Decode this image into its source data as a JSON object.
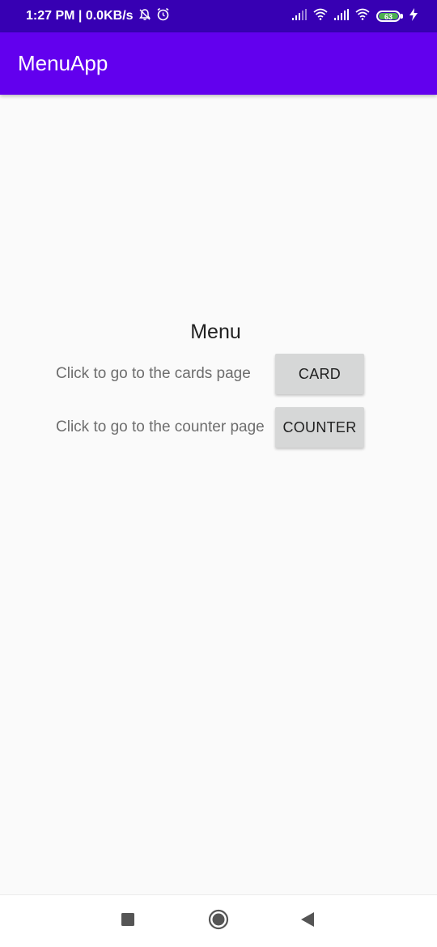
{
  "status_bar": {
    "time_speed": "1:27 PM | 0.0KB/s",
    "battery_level": "63",
    "icons": [
      "mute-bell-icon",
      "alarm-icon",
      "signal-icon",
      "wifi-icon",
      "signal-icon",
      "wifi-icon",
      "battery-icon",
      "charging-bolt-icon"
    ],
    "color": "#3700b3"
  },
  "app_bar": {
    "title": "MenuApp",
    "color": "#6200ee"
  },
  "menu": {
    "title": "Menu",
    "rows": [
      {
        "label": "Click to go to the cards page",
        "button": "CARD"
      },
      {
        "label": "Click to go to the counter page",
        "button": "COUNTER"
      }
    ]
  },
  "nav_bar": {
    "icons": [
      "recent-apps-icon",
      "home-icon",
      "back-icon"
    ]
  }
}
